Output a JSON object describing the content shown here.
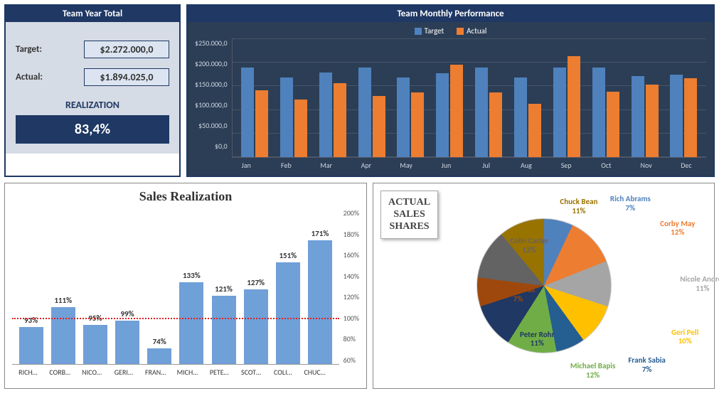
{
  "team_year_total": {
    "header": "Team Year Total",
    "target_label": "Target:",
    "target_value": "$2.272.000,0",
    "actual_label": "Actual:",
    "actual_value": "$1.894.025,0",
    "realization_label": "REALIZATION",
    "realization_pct": "83,4%"
  },
  "monthly": {
    "header": "Team Monthly Performance",
    "legend": {
      "target": "Target",
      "actual": "Actual"
    },
    "yticks": [
      "$250.000,0",
      "$200.000,0",
      "$150.000,0",
      "$100.000,0",
      "$50.000,0",
      "$0,0"
    ],
    "months": [
      "Jan",
      "Feb",
      "Mar",
      "Apr",
      "May",
      "Jun",
      "Jul",
      "Aug",
      "Sep",
      "Oct",
      "Nov",
      "Dec"
    ]
  },
  "sales_realization": {
    "title": "Sales Realization",
    "yticks": [
      "200%",
      "180%",
      "160%",
      "140%",
      "120%",
      "100%",
      "80%",
      "60%"
    ],
    "names": [
      "RICH…",
      "CORB…",
      "NICO…",
      "GERI…",
      "FRAN…",
      "MICH…",
      "PETE…",
      "SCOT…",
      "COLI…",
      "CHUC…"
    ],
    "values_label": [
      "93%",
      "111%",
      "95%",
      "99%",
      "74%",
      "133%",
      "121%",
      "127%",
      "151%",
      "171%"
    ]
  },
  "pie": {
    "badge_l1": "ACTUAL",
    "badge_l2": "SALES",
    "badge_l3": "SHARES",
    "slices": [
      {
        "name": "Rich Abrams",
        "pct": "7%",
        "color": "#4f81bd"
      },
      {
        "name": "Corby May",
        "pct": "12%",
        "color": "#ed7d31"
      },
      {
        "name": "Nicole Andres",
        "pct": "11%",
        "color": "#a5a5a5"
      },
      {
        "name": "Geri Pell",
        "pct": "10%",
        "color": "#ffc000"
      },
      {
        "name": "Frank Sabia",
        "pct": "7%",
        "color": "#255e91"
      },
      {
        "name": "Michael Bapis",
        "pct": "12%",
        "color": "#70ad47"
      },
      {
        "name": "Peter Rohr",
        "pct": "11%",
        "color": "#1f3864"
      },
      {
        "name": "Scott Tiras",
        "pct": "7%",
        "color": "#9e480e"
      },
      {
        "name": "Colin Carter",
        "pct": "12%",
        "color": "#636363"
      },
      {
        "name": "Chuck Bean",
        "pct": "11%",
        "color": "#997300"
      }
    ]
  },
  "chart_data": [
    {
      "type": "bar",
      "title": "Team Monthly Performance",
      "xlabel": "",
      "ylabel": "",
      "ylim": [
        0,
        250000
      ],
      "categories": [
        "Jan",
        "Feb",
        "Mar",
        "Apr",
        "May",
        "Jun",
        "Jul",
        "Aug",
        "Sep",
        "Oct",
        "Nov",
        "Dec"
      ],
      "series": [
        {
          "name": "Target",
          "values": [
            200000,
            178000,
            188000,
            200000,
            178000,
            186000,
            200000,
            178000,
            200000,
            200000,
            180000,
            184000
          ]
        },
        {
          "name": "Actual",
          "values": [
            148000,
            128000,
            164000,
            136000,
            144000,
            206000,
            144000,
            118000,
            224000,
            146000,
            162000,
            176000
          ]
        }
      ]
    },
    {
      "type": "bar",
      "title": "Sales Realization",
      "xlabel": "",
      "ylabel": "",
      "ylim": [
        60,
        200
      ],
      "reference_line": 100,
      "categories": [
        "Rich Abrams",
        "Corby May",
        "Nicole Andres",
        "Geri Pell",
        "Frank Sabia",
        "Michael Bapis",
        "Peter Rohr",
        "Scott Tiras",
        "Colin Carter",
        "Chuck Bean"
      ],
      "values": [
        93,
        111,
        95,
        99,
        74,
        133,
        121,
        127,
        151,
        171
      ]
    },
    {
      "type": "pie",
      "title": "Actual Sales Shares",
      "series": [
        {
          "name": "Rich Abrams",
          "value": 7
        },
        {
          "name": "Corby May",
          "value": 12
        },
        {
          "name": "Nicole Andres",
          "value": 11
        },
        {
          "name": "Geri Pell",
          "value": 10
        },
        {
          "name": "Frank Sabia",
          "value": 7
        },
        {
          "name": "Michael Bapis",
          "value": 12
        },
        {
          "name": "Peter Rohr",
          "value": 11
        },
        {
          "name": "Scott Tiras",
          "value": 7
        },
        {
          "name": "Colin Carter",
          "value": 12
        },
        {
          "name": "Chuck Bean",
          "value": 11
        }
      ]
    }
  ]
}
